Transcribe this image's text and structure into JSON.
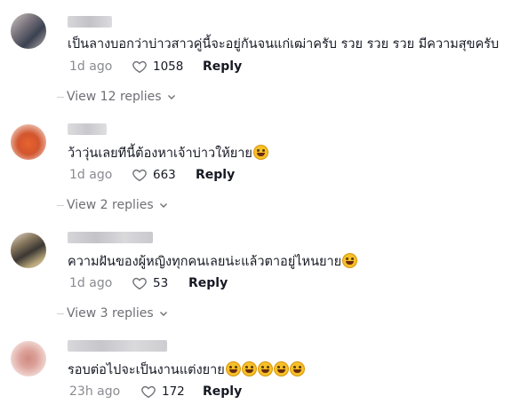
{
  "comments": [
    {
      "text": "เป็นลางบอกว่าบ่าวสาวคู่นี้จะอยู่กันจนแก่เฒ่าครับ รวย รวย รวย มีความสุขครับ",
      "emoji_count": 0,
      "time": "1d ago",
      "likes": "1058",
      "reply_label": "Reply",
      "view_replies": "View 12 replies",
      "avatar_colors": [
        "#c8c2bf",
        "#6c6670",
        "#3e4451",
        "#b5aaa8"
      ]
    },
    {
      "text": "ว้าวุ่นเลยทีนี้ต้องหาเจ้าบ่าวให้ยาย",
      "emoji_count": 1,
      "time": "1d ago",
      "likes": "663",
      "reply_label": "Reply",
      "view_replies": "View 2 replies",
      "avatar_colors": [
        "#e9c2b3",
        "#e06a3c",
        "#c74a2a",
        "#f0b49a"
      ]
    },
    {
      "text": "ความฝันของผู้หญิงทุกคนเลยน่ะแล้วตาอยู่ไหนยาย",
      "emoji_count": 1,
      "time": "1d ago",
      "likes": "53",
      "reply_label": "Reply",
      "view_replies": "View 3 replies",
      "avatar_colors": [
        "#d8cfc4",
        "#7a6a54",
        "#3e3a36",
        "#c9b98f"
      ]
    },
    {
      "text": "รอบต่อไปจะเป็นงานแต่งยาย",
      "emoji_count": 5,
      "time": "23h ago",
      "likes": "172",
      "reply_label": "Reply",
      "view_replies": "",
      "avatar_colors": [
        "#f0d6d2",
        "#d9958c",
        "#c47a74",
        "#f3e3df"
      ]
    }
  ],
  "colors": {
    "text_primary": "#161823",
    "text_secondary": "#8a8b91",
    "emoji_fill": "#f5c028"
  },
  "icons": {
    "like": "heart-outline-icon",
    "expand": "chevron-down-icon",
    "emoji": "rolling-laughing-emoji-icon"
  }
}
